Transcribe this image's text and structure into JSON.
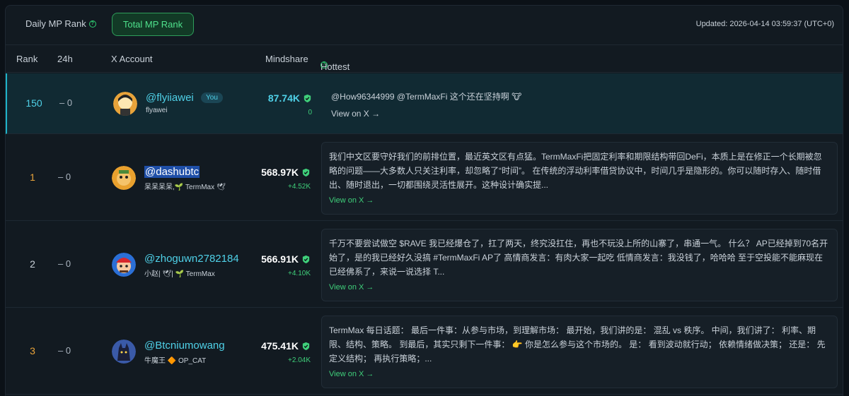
{
  "tabs": {
    "daily": "Daily MP Rank",
    "total": "Total MP Rank"
  },
  "updated": "Updated: 2026-04-14 03:59:37 (UTC+0)",
  "columns": {
    "rank": "Rank",
    "h24": "24h",
    "x": "X Account",
    "mind": "Mindshare",
    "hot": "Hottest Post"
  },
  "view_label": "View on X →",
  "rows": [
    {
      "rank": "150",
      "delta": "– 0",
      "handle": "@flyiiawei",
      "you": "You",
      "sub": "flyawei",
      "mind": "87.74K",
      "change": "0",
      "post": "@How96344999 @TermMaxFi 这个还在坚持啊 🐮"
    },
    {
      "rank": "1",
      "delta": "– 0",
      "handle": "@dashubtc",
      "sub": "呆呆呆呆,🌱 TermMax 🕊",
      "mind": "568.97K",
      "change": "+4.52K",
      "post": "我们中文区要守好我们的前排位置，最近英文区有点猛。TermMaxFi把固定利率和期限结构带回DeFi，本质上是在修正一个长期被忽略的问题——大多数人只关注利率，却忽略了“时间”。 在传统的浮动利率借贷协议中，时间几乎是隐形的。你可以随时存入、随时借出、随时退出，一切都围绕灵活性展开。这种设计确实提..."
    },
    {
      "rank": "2",
      "delta": "– 0",
      "handle": "@zhoguwn2782184",
      "sub": "小赵| 🕊| 🌱 TermMax",
      "mind": "566.91K",
      "change": "+4.10K",
      "post": "千万不要尝试做空 $RAVE 我已经爆仓了，扛了两天，终究没扛住，再也不玩没上所的山寨了，串通一气。 什么？ AP已经掉到70名开始了，是的我已经好久没搞 #TermMaxFi AP了 高情商发言：有肉大家一起吃 低情商发言：我没钱了，哈哈哈 至于空投能不能麻现在已经佛系了，来说一说选择 T..."
    },
    {
      "rank": "3",
      "delta": "– 0",
      "handle": "@Btcniumowang",
      "sub": "牛魔王 🔶 OP_CAT",
      "mind": "475.41K",
      "change": "+2.04K",
      "post": "TermMax 每日话题： 最后一件事：从参与市场，到理解市场： 最开始，我们讲的是： 混乱 vs 秩序。 中间，我们讲了： 利率、期限、结构、策略。 到最后，其实只剩下一件事： 👉 你是怎么参与这个市场的。 是： 看到波动就行动； 依赖情绪做决策； 还是： 先定义结构； 再执行策略；..."
    }
  ],
  "colors": {
    "accent": "#4ee08b",
    "cyan": "#4fd1e8",
    "gold": "#e8a33a",
    "green_change": "#3fcf7a"
  }
}
